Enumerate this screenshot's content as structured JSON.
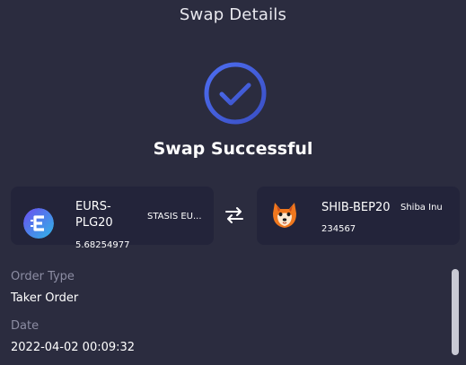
{
  "header": {
    "title": "Swap Details"
  },
  "status": {
    "text": "Swap Successful",
    "icon": "check-circle-icon",
    "accent": "#4a63d8"
  },
  "from_token": {
    "symbol": "EURS-PLG20",
    "name": "STASIS EU...",
    "amount": "5.68254977",
    "icon": "eurs-logo-icon"
  },
  "to_token": {
    "symbol": "SHIB-BEP20",
    "name": "Shiba Inu",
    "amount": "234567",
    "icon": "shib-logo-icon"
  },
  "swap_icon": "swap-arrows-icon",
  "details": {
    "order_type_label": "Order Type",
    "order_type_value": "Taker Order",
    "date_label": "Date",
    "date_value": "2022-04-02 00:09:32"
  }
}
